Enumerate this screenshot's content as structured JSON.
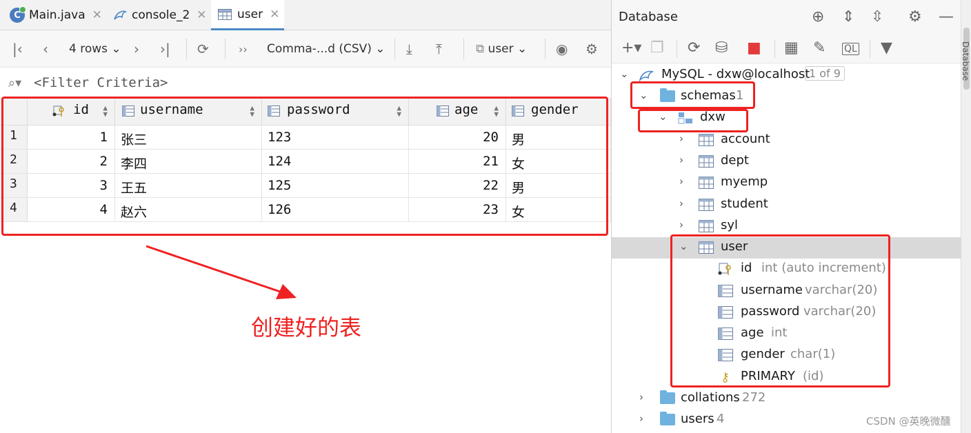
{
  "tabs": [
    {
      "label": "Main.java",
      "icon": "java-class-icon"
    },
    {
      "label": "console_2",
      "icon": "mysql-console-icon"
    },
    {
      "label": "user",
      "icon": "table-icon",
      "active": true
    }
  ],
  "toolbar": {
    "rows_label": "4 rows",
    "format_label": "Comma-...d (CSV)",
    "table_label": "user"
  },
  "filter": {
    "placeholder": "<Filter Criteria>"
  },
  "chart_data": {
    "type": "table",
    "columns": [
      "id",
      "username",
      "password",
      "age",
      "gender"
    ],
    "row_numbers": [
      "1",
      "2",
      "3",
      "4"
    ],
    "rows": [
      [
        "1",
        "张三",
        "123",
        "20",
        "男"
      ],
      [
        "2",
        "李四",
        "124",
        "21",
        "女"
      ],
      [
        "3",
        "王五",
        "125",
        "22",
        "男"
      ],
      [
        "4",
        "赵六",
        "126",
        "23",
        "女"
      ]
    ]
  },
  "annotation": {
    "text": "创建好的表",
    "color": "#ee2222"
  },
  "database_panel": {
    "title": "Database",
    "connection": {
      "label": "MySQL - dxw@localhost",
      "badge": "1 of 9"
    },
    "schemas": {
      "label": "schemas",
      "count": "1"
    },
    "schema": {
      "label": "dxw"
    },
    "tables": [
      "account",
      "dept",
      "myemp",
      "student",
      "syl",
      "user"
    ],
    "user_columns": [
      {
        "name": "id",
        "type": "int (auto increment)"
      },
      {
        "name": "username",
        "type": "varchar(20)"
      },
      {
        "name": "password",
        "type": "varchar(20)"
      },
      {
        "name": "age",
        "type": "int"
      },
      {
        "name": "gender",
        "type": "char(1)"
      }
    ],
    "primary": {
      "name": "PRIMARY",
      "type": "(id)"
    },
    "collations": {
      "label": "collations",
      "count": "272"
    },
    "users": {
      "label": "users",
      "count": "4"
    }
  },
  "side_tab": "Database",
  "watermark": "CSDN @英晚微醺",
  "colors": {
    "accent": "#4a88c7",
    "annotation_red": "#ee2222",
    "folder_blue": "#6fb2e0"
  }
}
